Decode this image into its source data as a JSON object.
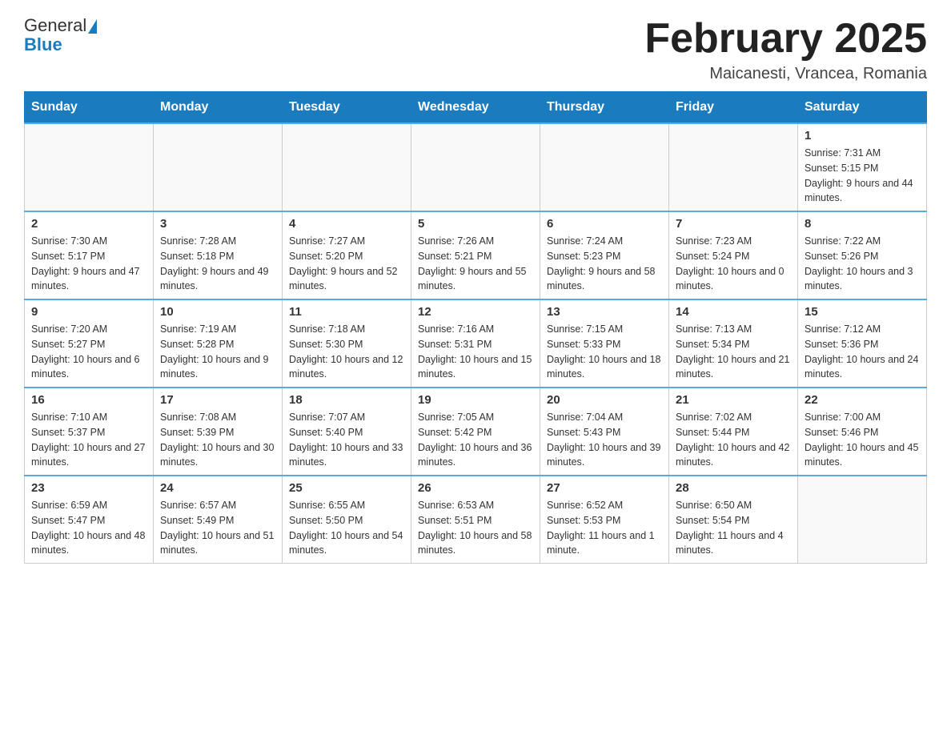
{
  "header": {
    "logo_text_general": "General",
    "logo_text_blue": "Blue",
    "month_title": "February 2025",
    "location": "Maicanesti, Vrancea, Romania"
  },
  "days_of_week": [
    "Sunday",
    "Monday",
    "Tuesday",
    "Wednesday",
    "Thursday",
    "Friday",
    "Saturday"
  ],
  "weeks": [
    [
      {
        "day": "",
        "info": ""
      },
      {
        "day": "",
        "info": ""
      },
      {
        "day": "",
        "info": ""
      },
      {
        "day": "",
        "info": ""
      },
      {
        "day": "",
        "info": ""
      },
      {
        "day": "",
        "info": ""
      },
      {
        "day": "1",
        "info": "Sunrise: 7:31 AM\nSunset: 5:15 PM\nDaylight: 9 hours and 44 minutes."
      }
    ],
    [
      {
        "day": "2",
        "info": "Sunrise: 7:30 AM\nSunset: 5:17 PM\nDaylight: 9 hours and 47 minutes."
      },
      {
        "day": "3",
        "info": "Sunrise: 7:28 AM\nSunset: 5:18 PM\nDaylight: 9 hours and 49 minutes."
      },
      {
        "day": "4",
        "info": "Sunrise: 7:27 AM\nSunset: 5:20 PM\nDaylight: 9 hours and 52 minutes."
      },
      {
        "day": "5",
        "info": "Sunrise: 7:26 AM\nSunset: 5:21 PM\nDaylight: 9 hours and 55 minutes."
      },
      {
        "day": "6",
        "info": "Sunrise: 7:24 AM\nSunset: 5:23 PM\nDaylight: 9 hours and 58 minutes."
      },
      {
        "day": "7",
        "info": "Sunrise: 7:23 AM\nSunset: 5:24 PM\nDaylight: 10 hours and 0 minutes."
      },
      {
        "day": "8",
        "info": "Sunrise: 7:22 AM\nSunset: 5:26 PM\nDaylight: 10 hours and 3 minutes."
      }
    ],
    [
      {
        "day": "9",
        "info": "Sunrise: 7:20 AM\nSunset: 5:27 PM\nDaylight: 10 hours and 6 minutes."
      },
      {
        "day": "10",
        "info": "Sunrise: 7:19 AM\nSunset: 5:28 PM\nDaylight: 10 hours and 9 minutes."
      },
      {
        "day": "11",
        "info": "Sunrise: 7:18 AM\nSunset: 5:30 PM\nDaylight: 10 hours and 12 minutes."
      },
      {
        "day": "12",
        "info": "Sunrise: 7:16 AM\nSunset: 5:31 PM\nDaylight: 10 hours and 15 minutes."
      },
      {
        "day": "13",
        "info": "Sunrise: 7:15 AM\nSunset: 5:33 PM\nDaylight: 10 hours and 18 minutes."
      },
      {
        "day": "14",
        "info": "Sunrise: 7:13 AM\nSunset: 5:34 PM\nDaylight: 10 hours and 21 minutes."
      },
      {
        "day": "15",
        "info": "Sunrise: 7:12 AM\nSunset: 5:36 PM\nDaylight: 10 hours and 24 minutes."
      }
    ],
    [
      {
        "day": "16",
        "info": "Sunrise: 7:10 AM\nSunset: 5:37 PM\nDaylight: 10 hours and 27 minutes."
      },
      {
        "day": "17",
        "info": "Sunrise: 7:08 AM\nSunset: 5:39 PM\nDaylight: 10 hours and 30 minutes."
      },
      {
        "day": "18",
        "info": "Sunrise: 7:07 AM\nSunset: 5:40 PM\nDaylight: 10 hours and 33 minutes."
      },
      {
        "day": "19",
        "info": "Sunrise: 7:05 AM\nSunset: 5:42 PM\nDaylight: 10 hours and 36 minutes."
      },
      {
        "day": "20",
        "info": "Sunrise: 7:04 AM\nSunset: 5:43 PM\nDaylight: 10 hours and 39 minutes."
      },
      {
        "day": "21",
        "info": "Sunrise: 7:02 AM\nSunset: 5:44 PM\nDaylight: 10 hours and 42 minutes."
      },
      {
        "day": "22",
        "info": "Sunrise: 7:00 AM\nSunset: 5:46 PM\nDaylight: 10 hours and 45 minutes."
      }
    ],
    [
      {
        "day": "23",
        "info": "Sunrise: 6:59 AM\nSunset: 5:47 PM\nDaylight: 10 hours and 48 minutes."
      },
      {
        "day": "24",
        "info": "Sunrise: 6:57 AM\nSunset: 5:49 PM\nDaylight: 10 hours and 51 minutes."
      },
      {
        "day": "25",
        "info": "Sunrise: 6:55 AM\nSunset: 5:50 PM\nDaylight: 10 hours and 54 minutes."
      },
      {
        "day": "26",
        "info": "Sunrise: 6:53 AM\nSunset: 5:51 PM\nDaylight: 10 hours and 58 minutes."
      },
      {
        "day": "27",
        "info": "Sunrise: 6:52 AM\nSunset: 5:53 PM\nDaylight: 11 hours and 1 minute."
      },
      {
        "day": "28",
        "info": "Sunrise: 6:50 AM\nSunset: 5:54 PM\nDaylight: 11 hours and 4 minutes."
      },
      {
        "day": "",
        "info": ""
      }
    ]
  ]
}
